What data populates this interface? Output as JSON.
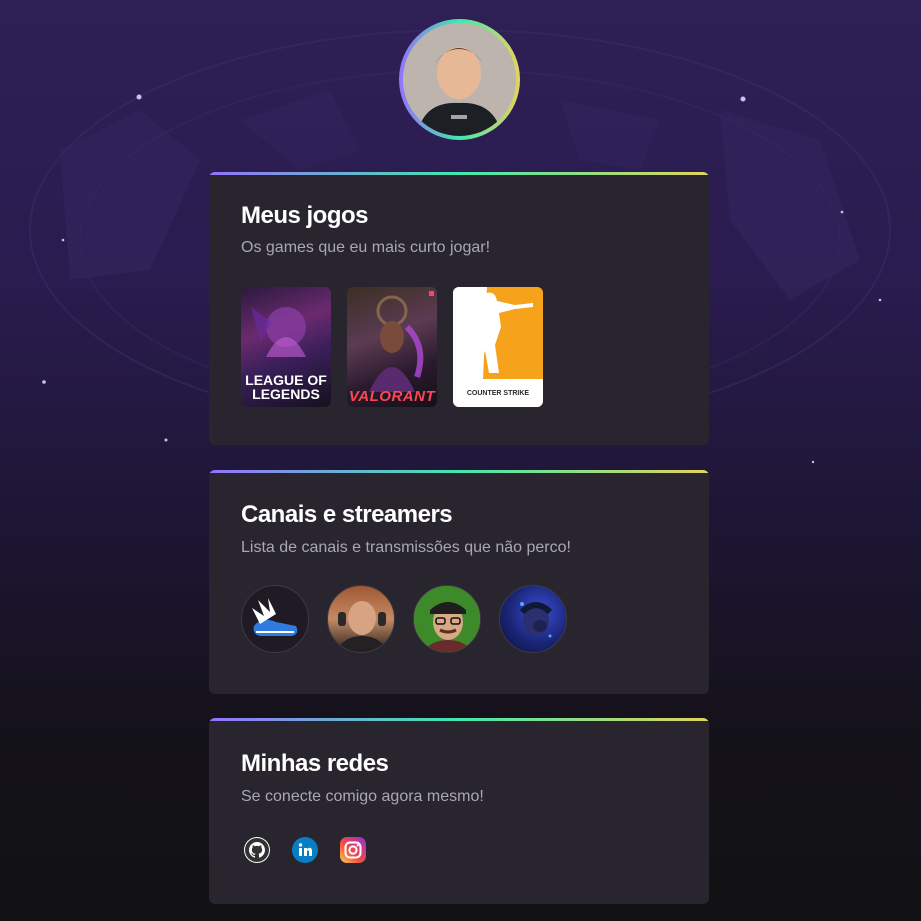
{
  "profile": {
    "avatar_alt": "Foto de perfil"
  },
  "games_card": {
    "title": "Meus jogos",
    "subtitle": "Os games que eu mais curto jogar!",
    "games": [
      {
        "name": "League of Legends",
        "label_line1": "LEAGUE OF",
        "label_line2": "LEGENDS"
      },
      {
        "name": "Valorant",
        "label": "VALORANT"
      },
      {
        "name": "Counter Strike",
        "label": "COUNTER STRIKE"
      }
    ]
  },
  "streamers_card": {
    "title": "Canais e streamers",
    "subtitle": "Lista de canais e transmissões que não perco!"
  },
  "socials_card": {
    "title": "Minhas redes",
    "subtitle": "Se conecte comigo agora mesmo!",
    "icons": [
      "github-icon",
      "linkedin-icon",
      "instagram-icon"
    ]
  },
  "colors": {
    "accent_gradient": [
      "#9572fc",
      "#43e7ad",
      "#e2d45c"
    ],
    "card_bg": "#29252f",
    "subtitle": "#a8a8b3"
  }
}
